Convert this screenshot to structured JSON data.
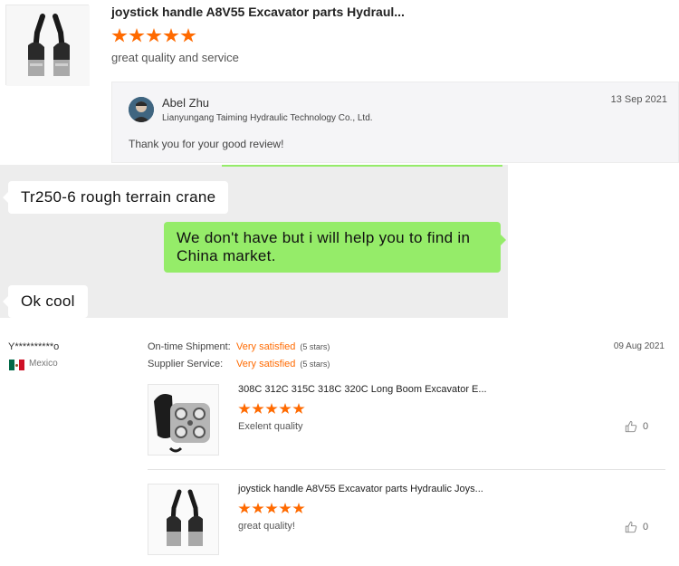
{
  "review1": {
    "title": "joystick handle A8V55 Excavator parts Hydraul...",
    "rating": 5,
    "comment": "great quality and service",
    "reply": {
      "name": "Abel Zhu",
      "company": "Lianyungang Taiming Hydraulic Technology Co., Ltd.",
      "date": "13 Sep 2021",
      "text": "Thank you for your good review!"
    }
  },
  "chat": {
    "messages": [
      {
        "side": "in",
        "text": "Tr250-6 rough terrain crane"
      },
      {
        "side": "out",
        "text": "We don't have but i will help you to find in China market."
      },
      {
        "side": "in",
        "text": "Ok cool"
      }
    ]
  },
  "review2": {
    "buyer": "Y**********o",
    "country": "Mexico",
    "date": "09 Aug 2021",
    "ontime": {
      "label": "On-time Shipment:",
      "value": "Very satisfied",
      "count": "(5 stars)"
    },
    "supplier": {
      "label": "Supplier Service:",
      "value": "Very satisfied",
      "count": "(5 stars)"
    },
    "products": [
      {
        "title": "308C 312C 315C 318C 320C Long Boom Excavator E...",
        "rating": 5,
        "comment": "Exelent quality",
        "likes": "0"
      },
      {
        "title": "joystick handle A8V55 Excavator parts Hydraulic Joys...",
        "rating": 5,
        "comment": "great quality!",
        "likes": "0"
      }
    ]
  },
  "colors": {
    "accent": "#ff6a00",
    "chat_out": "#95ec69",
    "chat_bg": "#ededed"
  },
  "icons": {
    "like": "thumbs-up-icon",
    "flag": "mexico-flag-icon",
    "star": "star-icon"
  }
}
